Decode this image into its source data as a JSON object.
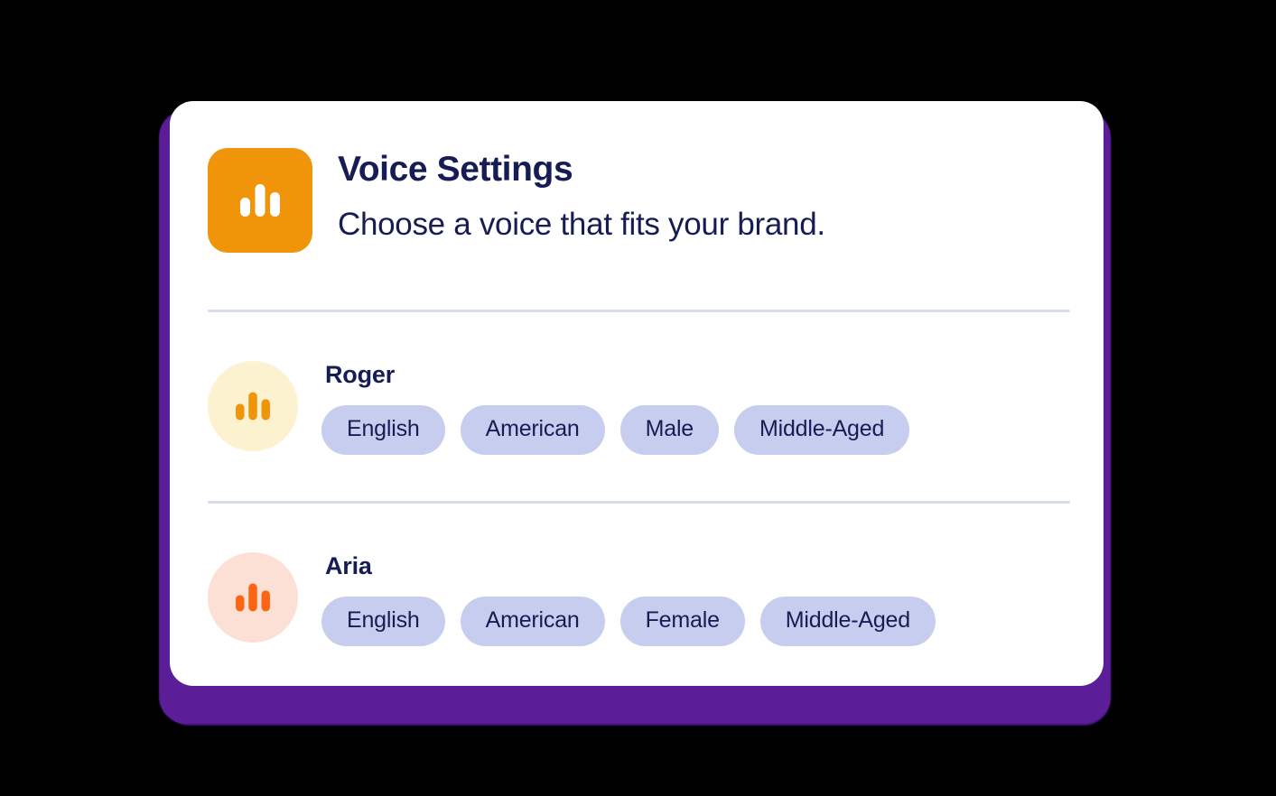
{
  "header": {
    "icon": "audio-bars-icon",
    "title": "Voice Settings",
    "subtitle": "Choose a voice that fits your brand."
  },
  "theme": {
    "card_background": "#ffffff",
    "backdrop": "#000000",
    "shadow_card": "#5c1d98",
    "icon_background": "#f09409",
    "icon_bars": "#ffffff",
    "text_primary": "#161c54",
    "divider": "#d7dcee",
    "tag_background": "#c7cdee",
    "tag_text": "#161c54"
  },
  "voices": [
    {
      "name": "Roger",
      "avatar_icon": "audio-bars-icon",
      "avatar_background": "#fdf2cf",
      "avatar_bars": "#f09409",
      "tags": [
        "English",
        "American",
        "Male",
        "Middle-Aged"
      ]
    },
    {
      "name": "Aria",
      "avatar_icon": "audio-bars-icon",
      "avatar_background": "#fde0d5",
      "avatar_bars": "#fb6514",
      "tags": [
        "English",
        "American",
        "Female",
        "Middle-Aged"
      ]
    }
  ]
}
